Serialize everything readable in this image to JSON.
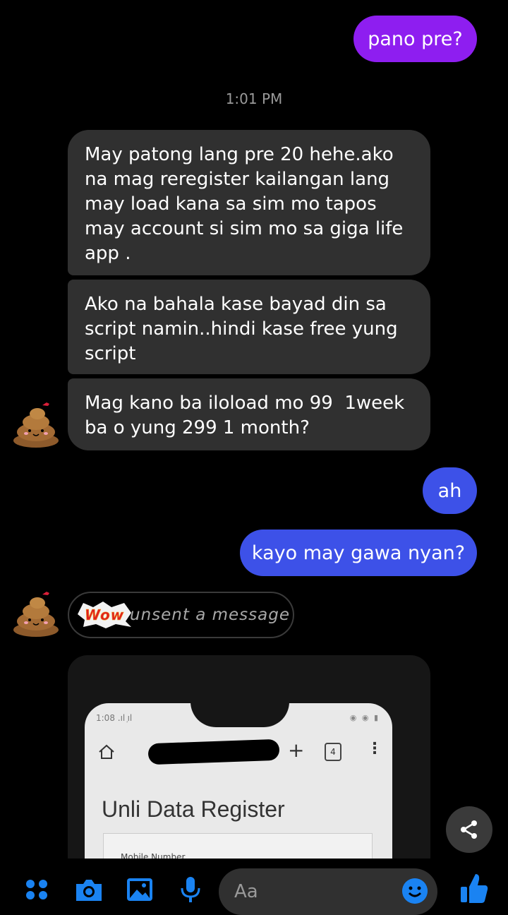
{
  "messages": {
    "out1": "pano pre?",
    "timestamp": "1:01 PM",
    "in1": "May patong lang pre 20 hehe.ako na mag reregister kailangan lang may load kana sa sim mo tapos may account si sim mo sa giga life app .",
    "in2": "Ako na bahala kase bayad din sa script namin..hindi kase free yung script",
    "in3": "Mag kano ba iloload mo 99  1week ba o yung 299 1 month?",
    "out2": "ah",
    "out3": "kayo may gawa nyan?",
    "unsent": "unsent a message"
  },
  "photo": {
    "status_time": "1:08",
    "tab_count": "4",
    "title": "Unli Data Register",
    "field_label": "Mobile Number"
  },
  "composer": {
    "placeholder": "Aa"
  },
  "colors": {
    "outgoing_purple": "#8e1ef0",
    "outgoing_blue": "#3d51e8",
    "incoming": "#303030",
    "accent": "#1a83f2"
  },
  "icons": [
    "menu-dots-icon",
    "camera-icon",
    "image-icon",
    "mic-icon",
    "emoji-icon",
    "thumbs-up-icon",
    "share-icon"
  ]
}
